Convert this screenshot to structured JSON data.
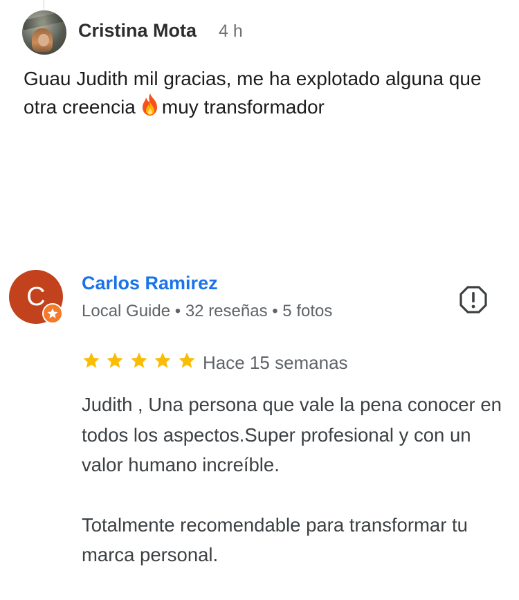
{
  "comment": {
    "author": "Cristina Mota",
    "time": "4 h",
    "text_before_emoji": "Guau Judith mil gracias, me ha explotado alguna que otra creencia",
    "emoji": "fire-icon",
    "text_after_emoji": "muy transformador"
  },
  "review": {
    "avatar_initial": "C",
    "avatar_color": "#c1421c",
    "author": "Carlos Ramirez",
    "meta": "Local Guide • 32 reseñas • 5 fotos",
    "rating": 5,
    "rating_color": "#fbbc04",
    "date": "Hace 15 semanas",
    "paragraphs": [
      "Judith , Una persona que vale la pena conocer en todos los aspectos.Super profesional y con un valor humano increíble.",
      "Totalmente recomendable para transformar tu marca personal."
    ],
    "report_icon": "report-flag-icon"
  },
  "colors": {
    "link_blue": "#1a73e8",
    "local_guide_badge": "#f27c2c"
  }
}
